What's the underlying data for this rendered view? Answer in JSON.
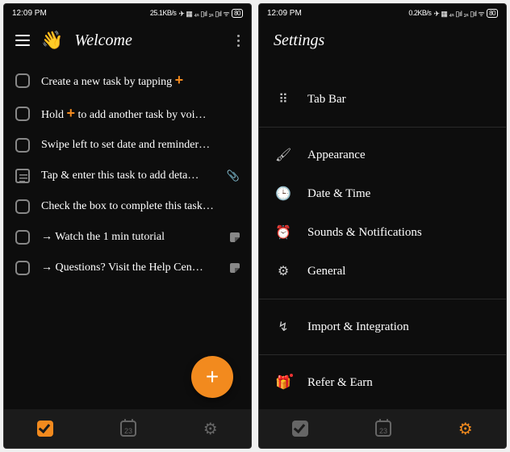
{
  "status": {
    "time": "12:09 PM",
    "net_left": "25.1KB/s",
    "net_right": "0.2KB/s",
    "battery": "80"
  },
  "left": {
    "title": "Welcome",
    "tasks": [
      {
        "pre": "Create a new task by tapping ",
        "plus": "+",
        "post": ""
      },
      {
        "pre": "Hold ",
        "plus": "+",
        "post": " to add another task by voi…"
      },
      {
        "text": "Swipe left to set date and reminder…"
      },
      {
        "text": "Tap & enter this task to add deta…",
        "note_icon": true,
        "clip": true
      },
      {
        "text": "Check the box to complete this task…"
      },
      {
        "text": "→ Watch the 1 min tutorial",
        "doc": true
      },
      {
        "text": "→ Questions? Visit the Help Cen…",
        "doc": true
      }
    ],
    "fab": "+",
    "cal_day": "23"
  },
  "right": {
    "title": "Settings",
    "items": [
      {
        "icon": "⠿",
        "label": "Tab Bar"
      },
      {
        "icon": "🖌",
        "label": "Appearance"
      },
      {
        "icon": "🕒",
        "label": "Date & Time"
      },
      {
        "icon": "⏰",
        "label": "Sounds & Notifications"
      },
      {
        "icon": "⚙",
        "label": "General"
      },
      {
        "icon": "↯",
        "label": "Import & Integration"
      },
      {
        "icon": "🎁",
        "label": "Refer & Earn",
        "dot": true
      }
    ],
    "cal_day": "23"
  }
}
